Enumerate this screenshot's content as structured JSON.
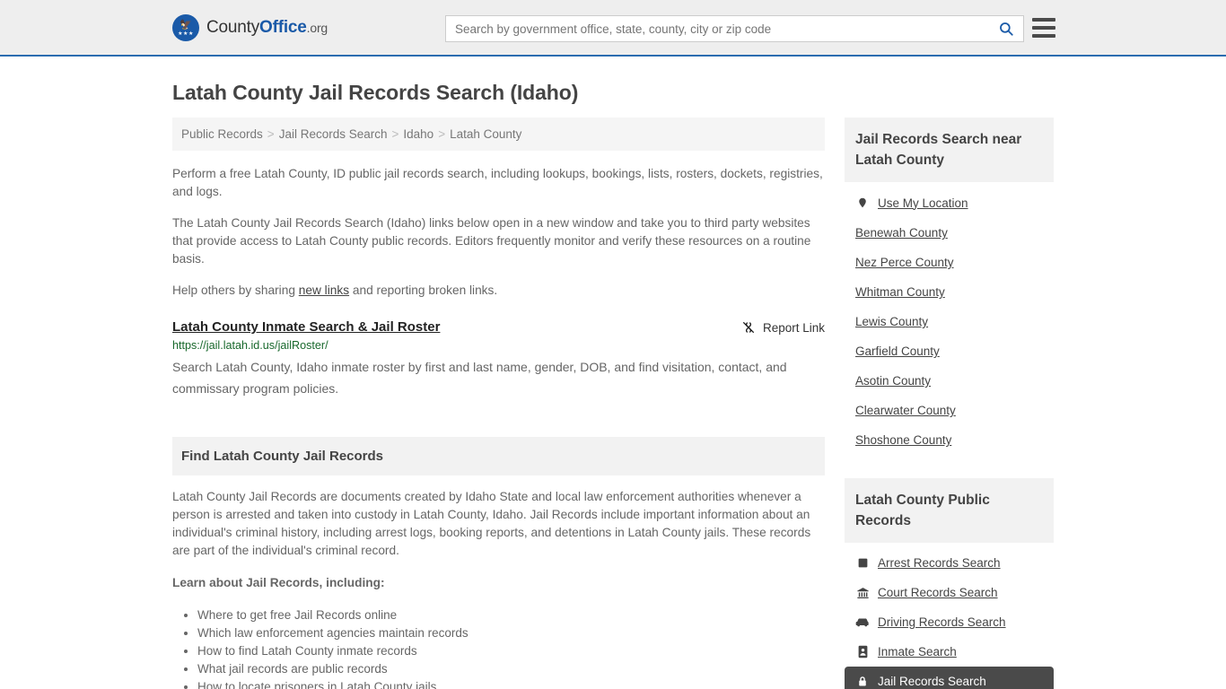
{
  "header": {
    "logo": {
      "county_text": "County",
      "office_text": "Office",
      "tld_text": ".org",
      "mark_icon": "eagle-icon",
      "stars_glyph": "★★★"
    },
    "search": {
      "placeholder": "Search by government office, state, county, city or zip code",
      "value": "",
      "search_icon": "search-icon"
    },
    "menu_icon": "hamburger-menu-icon"
  },
  "main": {
    "title": "Latah County Jail Records Search (Idaho)",
    "breadcrumb": {
      "separator": ">",
      "items": [
        {
          "label": "Public Records"
        },
        {
          "label": "Jail Records Search"
        },
        {
          "label": "Idaho"
        },
        {
          "label": "Latah County"
        }
      ]
    },
    "intro_p1": "Perform a free Latah County, ID public jail records search, including lookups, bookings, lists, rosters, dockets, registries, and logs.",
    "intro_p2": "The Latah County Jail Records Search (Idaho) links below open in a new window and take you to third party websites that provide access to Latah County public records. Editors frequently monitor and verify these resources on a routine basis.",
    "share_prefix": "Help others by sharing ",
    "share_link": "new links",
    "share_suffix": " and reporting broken links.",
    "result": {
      "title": "Latah County Inmate Search & Jail Roster",
      "url": "https://jail.latah.id.us/jailRoster/",
      "description": "Search Latah County, Idaho inmate roster by first and last name, gender, DOB, and find visitation, contact, and commissary program policies.",
      "report_label": "Report Link",
      "report_icon": "broken-link-icon"
    },
    "section": {
      "heading": "Find Latah County Jail Records",
      "paragraph": "Latah County Jail Records are documents created by Idaho State and local law enforcement authorities whenever a person is arrested and taken into custody in Latah County, Idaho. Jail Records include important information about an individual's criminal history, including arrest logs, booking reports, and detentions in Latah County jails. These records are part of the individual's criminal record.",
      "learn_label": "Learn about Jail Records, including:",
      "learn_items": [
        "Where to get free Jail Records online",
        "Which law enforcement agencies maintain records",
        "How to find Latah County inmate records",
        "What jail records are public records",
        "How to locate prisoners in Latah County jails"
      ]
    }
  },
  "sidebar": {
    "nearby": {
      "heading": "Jail Records Search near Latah County",
      "use_location": {
        "label": "Use My Location",
        "icon": "map-pin-icon"
      },
      "counties": [
        {
          "label": "Benewah County"
        },
        {
          "label": "Nez Perce County"
        },
        {
          "label": "Whitman County"
        },
        {
          "label": "Lewis County"
        },
        {
          "label": "Garfield County"
        },
        {
          "label": "Asotin County"
        },
        {
          "label": "Clearwater County"
        },
        {
          "label": "Shoshone County"
        }
      ]
    },
    "public_records": {
      "heading": "Latah County Public Records",
      "items": [
        {
          "label": "Arrest Records Search",
          "icon": "fingerprint-card-icon",
          "active": false
        },
        {
          "label": "Court Records Search",
          "icon": "courthouse-icon",
          "active": false
        },
        {
          "label": "Driving Records Search",
          "icon": "car-icon",
          "active": false
        },
        {
          "label": "Inmate Search",
          "icon": "id-card-icon",
          "active": false
        },
        {
          "label": "Jail Records Search",
          "icon": "lock-icon",
          "active": true
        }
      ]
    }
  },
  "colors": {
    "brand_blue": "#1a5aa8",
    "header_bg": "#eeeeee",
    "header_border": "#2b6cb0",
    "panel_bg": "#f2f2f2",
    "url_green": "#18682c",
    "active_bg": "#4a4a4a"
  }
}
